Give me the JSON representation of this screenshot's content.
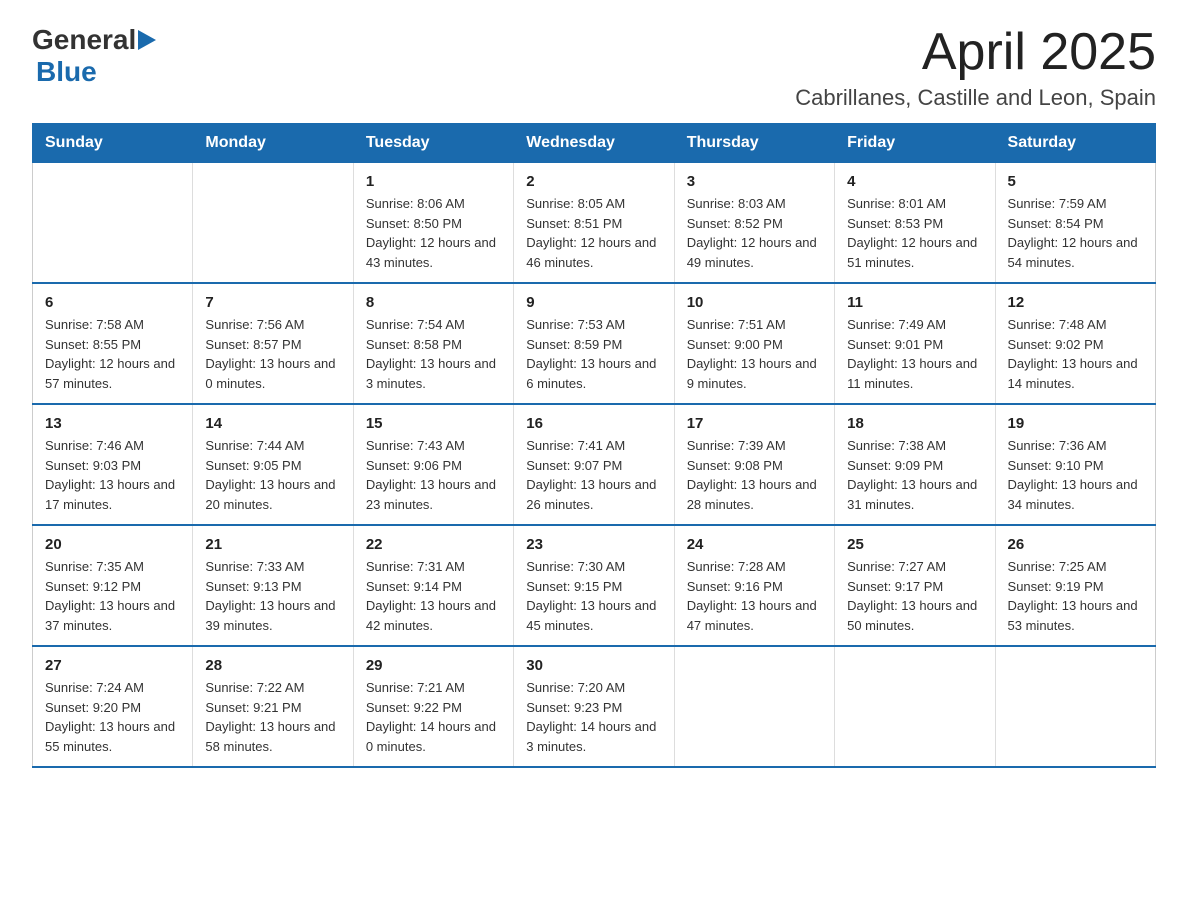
{
  "header": {
    "logo_general": "General",
    "logo_blue": "Blue",
    "title": "April 2025",
    "subtitle": "Cabrillanes, Castille and Leon, Spain"
  },
  "weekdays": [
    "Sunday",
    "Monday",
    "Tuesday",
    "Wednesday",
    "Thursday",
    "Friday",
    "Saturday"
  ],
  "weeks": [
    [
      {
        "day": "",
        "info": ""
      },
      {
        "day": "",
        "info": ""
      },
      {
        "day": "1",
        "info": "Sunrise: 8:06 AM\nSunset: 8:50 PM\nDaylight: 12 hours\nand 43 minutes."
      },
      {
        "day": "2",
        "info": "Sunrise: 8:05 AM\nSunset: 8:51 PM\nDaylight: 12 hours\nand 46 minutes."
      },
      {
        "day": "3",
        "info": "Sunrise: 8:03 AM\nSunset: 8:52 PM\nDaylight: 12 hours\nand 49 minutes."
      },
      {
        "day": "4",
        "info": "Sunrise: 8:01 AM\nSunset: 8:53 PM\nDaylight: 12 hours\nand 51 minutes."
      },
      {
        "day": "5",
        "info": "Sunrise: 7:59 AM\nSunset: 8:54 PM\nDaylight: 12 hours\nand 54 minutes."
      }
    ],
    [
      {
        "day": "6",
        "info": "Sunrise: 7:58 AM\nSunset: 8:55 PM\nDaylight: 12 hours\nand 57 minutes."
      },
      {
        "day": "7",
        "info": "Sunrise: 7:56 AM\nSunset: 8:57 PM\nDaylight: 13 hours\nand 0 minutes."
      },
      {
        "day": "8",
        "info": "Sunrise: 7:54 AM\nSunset: 8:58 PM\nDaylight: 13 hours\nand 3 minutes."
      },
      {
        "day": "9",
        "info": "Sunrise: 7:53 AM\nSunset: 8:59 PM\nDaylight: 13 hours\nand 6 minutes."
      },
      {
        "day": "10",
        "info": "Sunrise: 7:51 AM\nSunset: 9:00 PM\nDaylight: 13 hours\nand 9 minutes."
      },
      {
        "day": "11",
        "info": "Sunrise: 7:49 AM\nSunset: 9:01 PM\nDaylight: 13 hours\nand 11 minutes."
      },
      {
        "day": "12",
        "info": "Sunrise: 7:48 AM\nSunset: 9:02 PM\nDaylight: 13 hours\nand 14 minutes."
      }
    ],
    [
      {
        "day": "13",
        "info": "Sunrise: 7:46 AM\nSunset: 9:03 PM\nDaylight: 13 hours\nand 17 minutes."
      },
      {
        "day": "14",
        "info": "Sunrise: 7:44 AM\nSunset: 9:05 PM\nDaylight: 13 hours\nand 20 minutes."
      },
      {
        "day": "15",
        "info": "Sunrise: 7:43 AM\nSunset: 9:06 PM\nDaylight: 13 hours\nand 23 minutes."
      },
      {
        "day": "16",
        "info": "Sunrise: 7:41 AM\nSunset: 9:07 PM\nDaylight: 13 hours\nand 26 minutes."
      },
      {
        "day": "17",
        "info": "Sunrise: 7:39 AM\nSunset: 9:08 PM\nDaylight: 13 hours\nand 28 minutes."
      },
      {
        "day": "18",
        "info": "Sunrise: 7:38 AM\nSunset: 9:09 PM\nDaylight: 13 hours\nand 31 minutes."
      },
      {
        "day": "19",
        "info": "Sunrise: 7:36 AM\nSunset: 9:10 PM\nDaylight: 13 hours\nand 34 minutes."
      }
    ],
    [
      {
        "day": "20",
        "info": "Sunrise: 7:35 AM\nSunset: 9:12 PM\nDaylight: 13 hours\nand 37 minutes."
      },
      {
        "day": "21",
        "info": "Sunrise: 7:33 AM\nSunset: 9:13 PM\nDaylight: 13 hours\nand 39 minutes."
      },
      {
        "day": "22",
        "info": "Sunrise: 7:31 AM\nSunset: 9:14 PM\nDaylight: 13 hours\nand 42 minutes."
      },
      {
        "day": "23",
        "info": "Sunrise: 7:30 AM\nSunset: 9:15 PM\nDaylight: 13 hours\nand 45 minutes."
      },
      {
        "day": "24",
        "info": "Sunrise: 7:28 AM\nSunset: 9:16 PM\nDaylight: 13 hours\nand 47 minutes."
      },
      {
        "day": "25",
        "info": "Sunrise: 7:27 AM\nSunset: 9:17 PM\nDaylight: 13 hours\nand 50 minutes."
      },
      {
        "day": "26",
        "info": "Sunrise: 7:25 AM\nSunset: 9:19 PM\nDaylight: 13 hours\nand 53 minutes."
      }
    ],
    [
      {
        "day": "27",
        "info": "Sunrise: 7:24 AM\nSunset: 9:20 PM\nDaylight: 13 hours\nand 55 minutes."
      },
      {
        "day": "28",
        "info": "Sunrise: 7:22 AM\nSunset: 9:21 PM\nDaylight: 13 hours\nand 58 minutes."
      },
      {
        "day": "29",
        "info": "Sunrise: 7:21 AM\nSunset: 9:22 PM\nDaylight: 14 hours\nand 0 minutes."
      },
      {
        "day": "30",
        "info": "Sunrise: 7:20 AM\nSunset: 9:23 PM\nDaylight: 14 hours\nand 3 minutes."
      },
      {
        "day": "",
        "info": ""
      },
      {
        "day": "",
        "info": ""
      },
      {
        "day": "",
        "info": ""
      }
    ]
  ]
}
